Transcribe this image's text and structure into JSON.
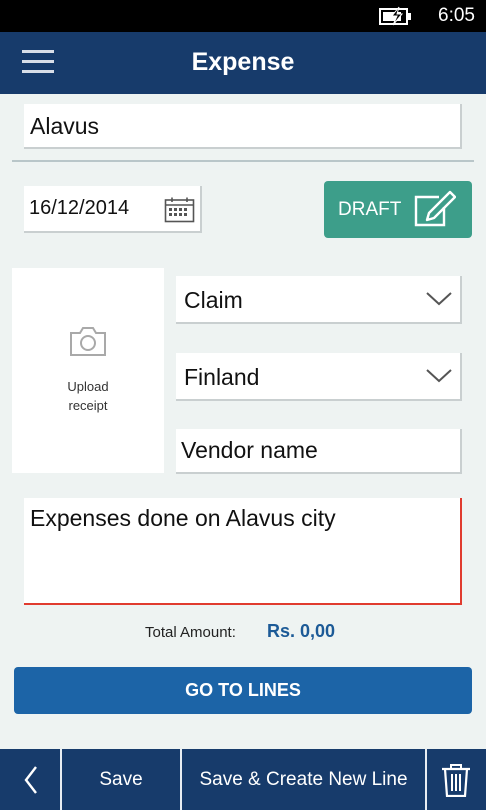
{
  "status_bar": {
    "time": "6:05",
    "battery_icon": "battery-charging-icon"
  },
  "header": {
    "title": "Expense",
    "menu_icon": "hamburger-menu-icon"
  },
  "form": {
    "title_value": "Alavus",
    "date_value": "16/12/2014",
    "date_icon": "calendar-icon",
    "status_label": "DRAFT",
    "status_icon": "edit-icon",
    "upload": {
      "icon": "camera-icon",
      "line1": "Upload",
      "line2": "receipt"
    },
    "type_value": "Claim",
    "country_value": "Finland",
    "vendor_value": "Vendor name",
    "description_value": "Expenses done on Alavus city"
  },
  "totals": {
    "label": "Total Amount:",
    "value": "Rs. 0,00"
  },
  "actions": {
    "go_to_lines": "GO TO LINES"
  },
  "bottom_bar": {
    "back_icon": "chevron-left-icon",
    "save_label": "Save",
    "save_new_label": "Save & Create New Line",
    "delete_icon": "trash-icon"
  },
  "colors": {
    "primary_navy": "#173b6b",
    "accent_teal": "#3d9e8a",
    "button_blue": "#1c64a7",
    "error_red": "#e03b2f",
    "amount_blue": "#1c5a97"
  }
}
